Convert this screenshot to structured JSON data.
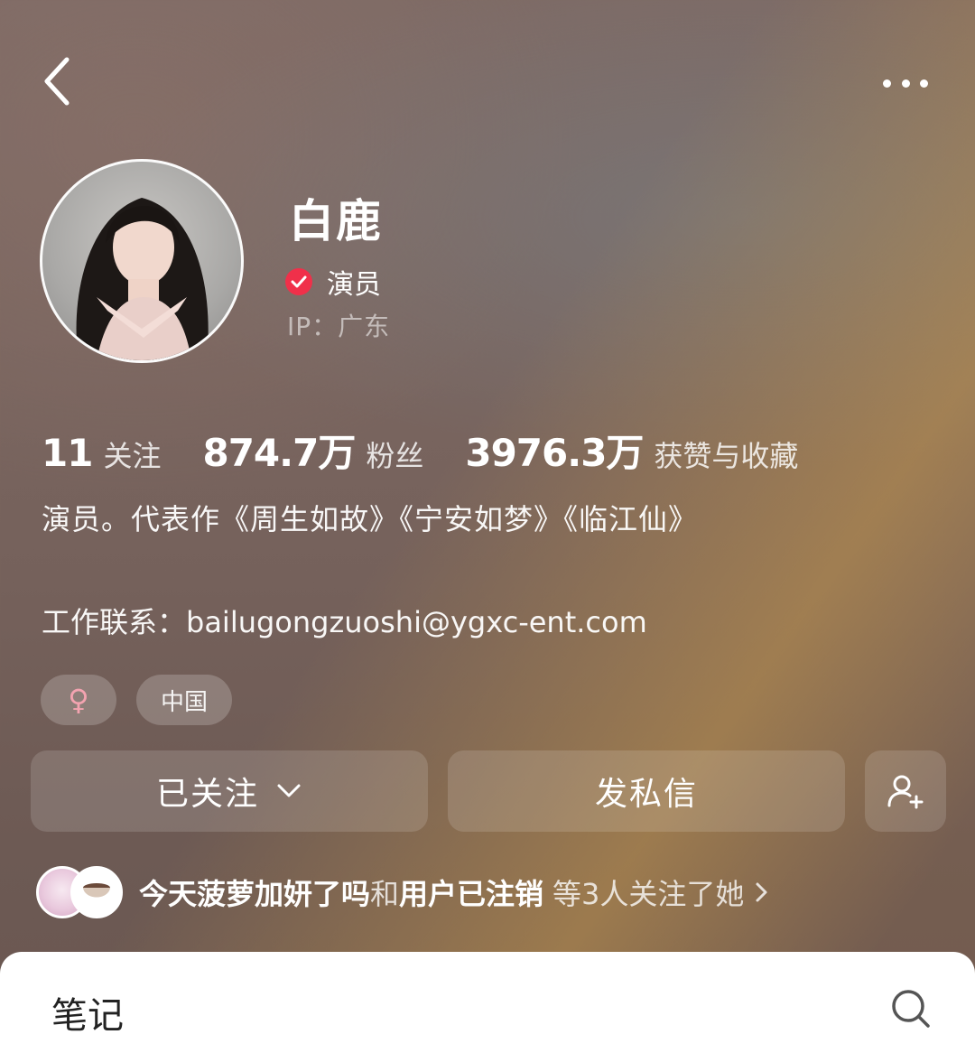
{
  "profile": {
    "name": "白鹿",
    "verified_label": "演员",
    "ip": "IP：广东"
  },
  "stats": [
    {
      "value": "11",
      "label": "关注"
    },
    {
      "value": "874.7万",
      "label": "粉丝"
    },
    {
      "value": "3976.3万",
      "label": "获赞与收藏"
    }
  ],
  "bio": "演员。代表作《周生如故》《宁安如梦》《临江仙》",
  "contact": "工作联系：bailugongzuoshi@ygxc-ent.com",
  "tags": {
    "gender": "♀",
    "country": "中国"
  },
  "actions": {
    "follow_label": "已关注",
    "message_label": "发私信"
  },
  "followers": {
    "name1": "今天菠萝加妍了吗",
    "connector": "和",
    "name2": "用户已注销",
    "suffix": "等3人关注了她"
  },
  "tabs": {
    "notes_label": "笔记"
  },
  "colors": {
    "verified": "#f0304a",
    "gender_tag": "#f3a3b0"
  },
  "icons": [
    "back-arrow-icon",
    "more-icon",
    "verified-check-icon",
    "chevron-down-icon",
    "add-friend-icon",
    "chevron-right-icon",
    "search-icon"
  ]
}
